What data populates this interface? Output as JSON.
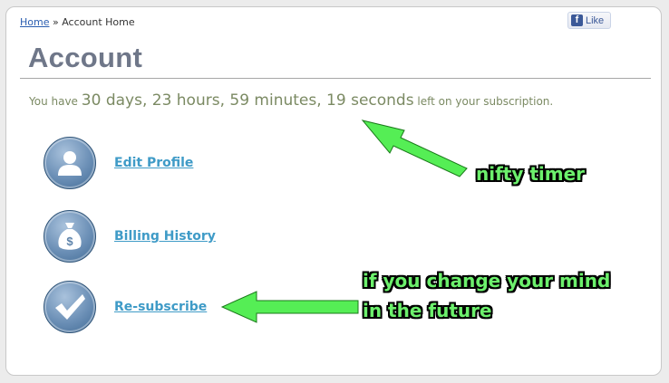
{
  "breadcrumb": {
    "home": "Home",
    "separator": "»",
    "current": "Account Home"
  },
  "facebook": {
    "f": "f",
    "label": "Like"
  },
  "page": {
    "title": "Account"
  },
  "subscription": {
    "prefix": "You have",
    "remaining": "30 days, 23 hours, 59 minutes, 19 seconds",
    "suffix": "left on your subscription."
  },
  "menu": [
    {
      "label": "Edit Profile",
      "icon": "profile-icon"
    },
    {
      "label": "Billing History",
      "icon": "money-bag-icon"
    },
    {
      "label": "Re-subscribe",
      "icon": "checkmark-icon"
    }
  ],
  "annotations": {
    "timer_note": "nifty timer",
    "resubscribe_note_line1": "if you change your mind",
    "resubscribe_note_line2": "in the future"
  },
  "colors": {
    "title": "#6f7789",
    "timer_text": "#7b8a63",
    "link": "#3f9bc7",
    "annotation": "#6cf06c",
    "arrow": "#55ee55"
  }
}
